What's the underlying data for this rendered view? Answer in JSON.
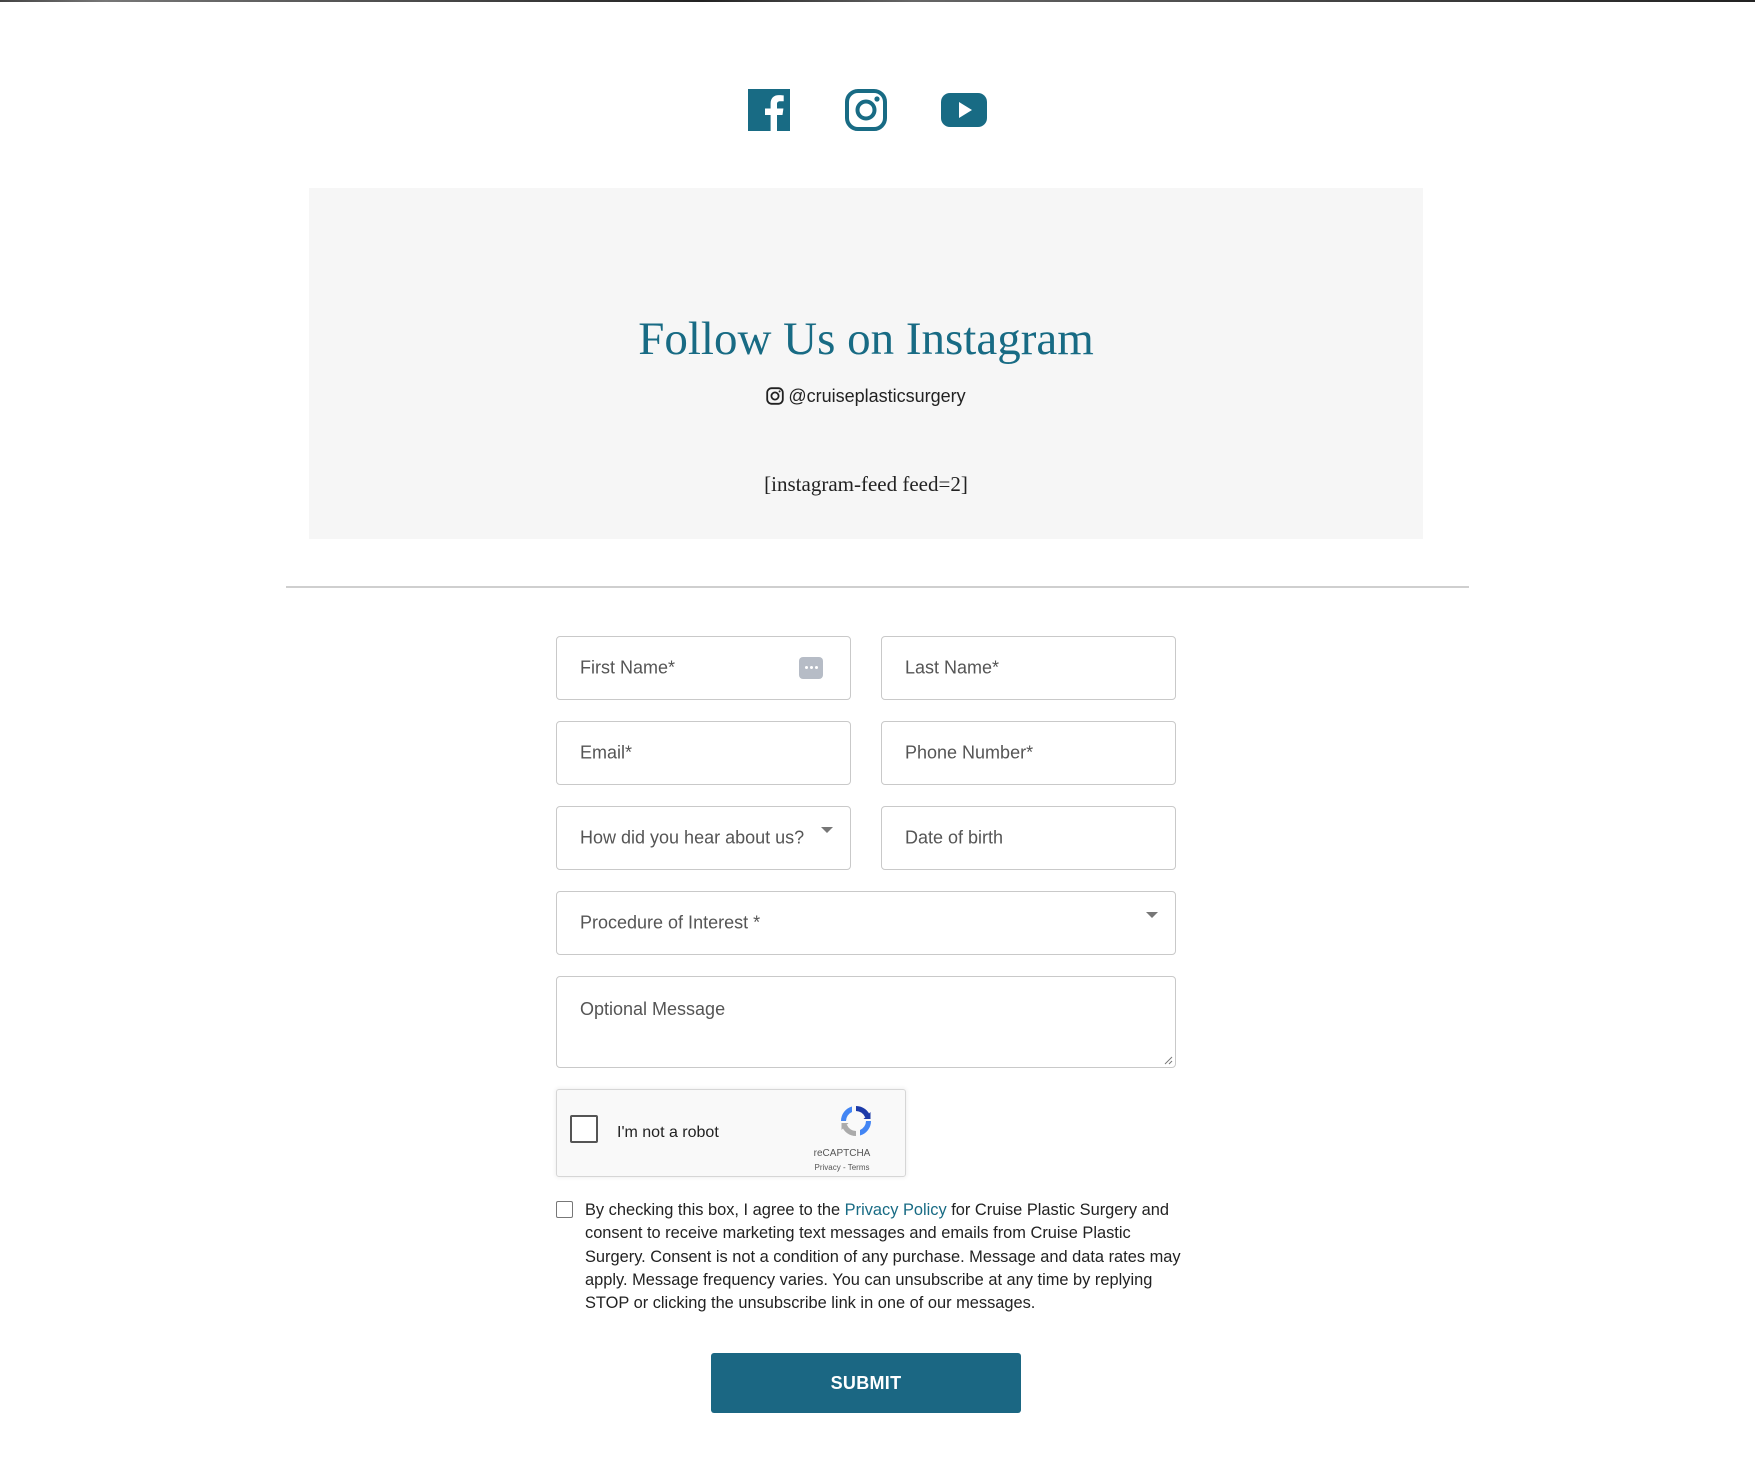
{
  "colors": {
    "accent": "#186b84",
    "button": "#1b6783",
    "panel_bg": "#f6f6f6",
    "border": "#c9c9c9"
  },
  "social": [
    {
      "name": "facebook",
      "icon": "facebook-icon"
    },
    {
      "name": "instagram",
      "icon": "instagram-icon"
    },
    {
      "name": "youtube",
      "icon": "youtube-icon"
    }
  ],
  "instagram_section": {
    "title": "Follow Us on Instagram",
    "handle": "@cruiseplasticsurgery",
    "handle_icon": "instagram-icon",
    "shortcode": "[instagram-feed feed=2]"
  },
  "form": {
    "first_name": "First Name*",
    "last_name": "Last Name*",
    "email": "Email*",
    "phone": "Phone Number*",
    "referral": "How did you hear about us?",
    "dob": "Date of birth",
    "procedure": "Procedure of Interest *",
    "message": "Optional Message",
    "autofill_icon": "autofill-dots-icon",
    "dropdown_icon": "caret-down-icon"
  },
  "recaptcha": {
    "label": "I'm not a robot",
    "brand": "reCAPTCHA",
    "links": "Privacy - Terms",
    "icon": "recaptcha-logo-icon"
  },
  "consent": {
    "text_before": "By checking this box, I agree to the ",
    "link": "Privacy Policy",
    "text_after": " for Cruise Plastic Surgery and consent to receive marketing text messages and emails from Cruise Plastic Surgery. Consent is not a condition of any purchase. Message and data rates may apply. Message frequency varies. You can unsubscribe at any time by replying STOP or clicking the unsubscribe link in one of our messages."
  },
  "submit_label": "SUBMIT"
}
